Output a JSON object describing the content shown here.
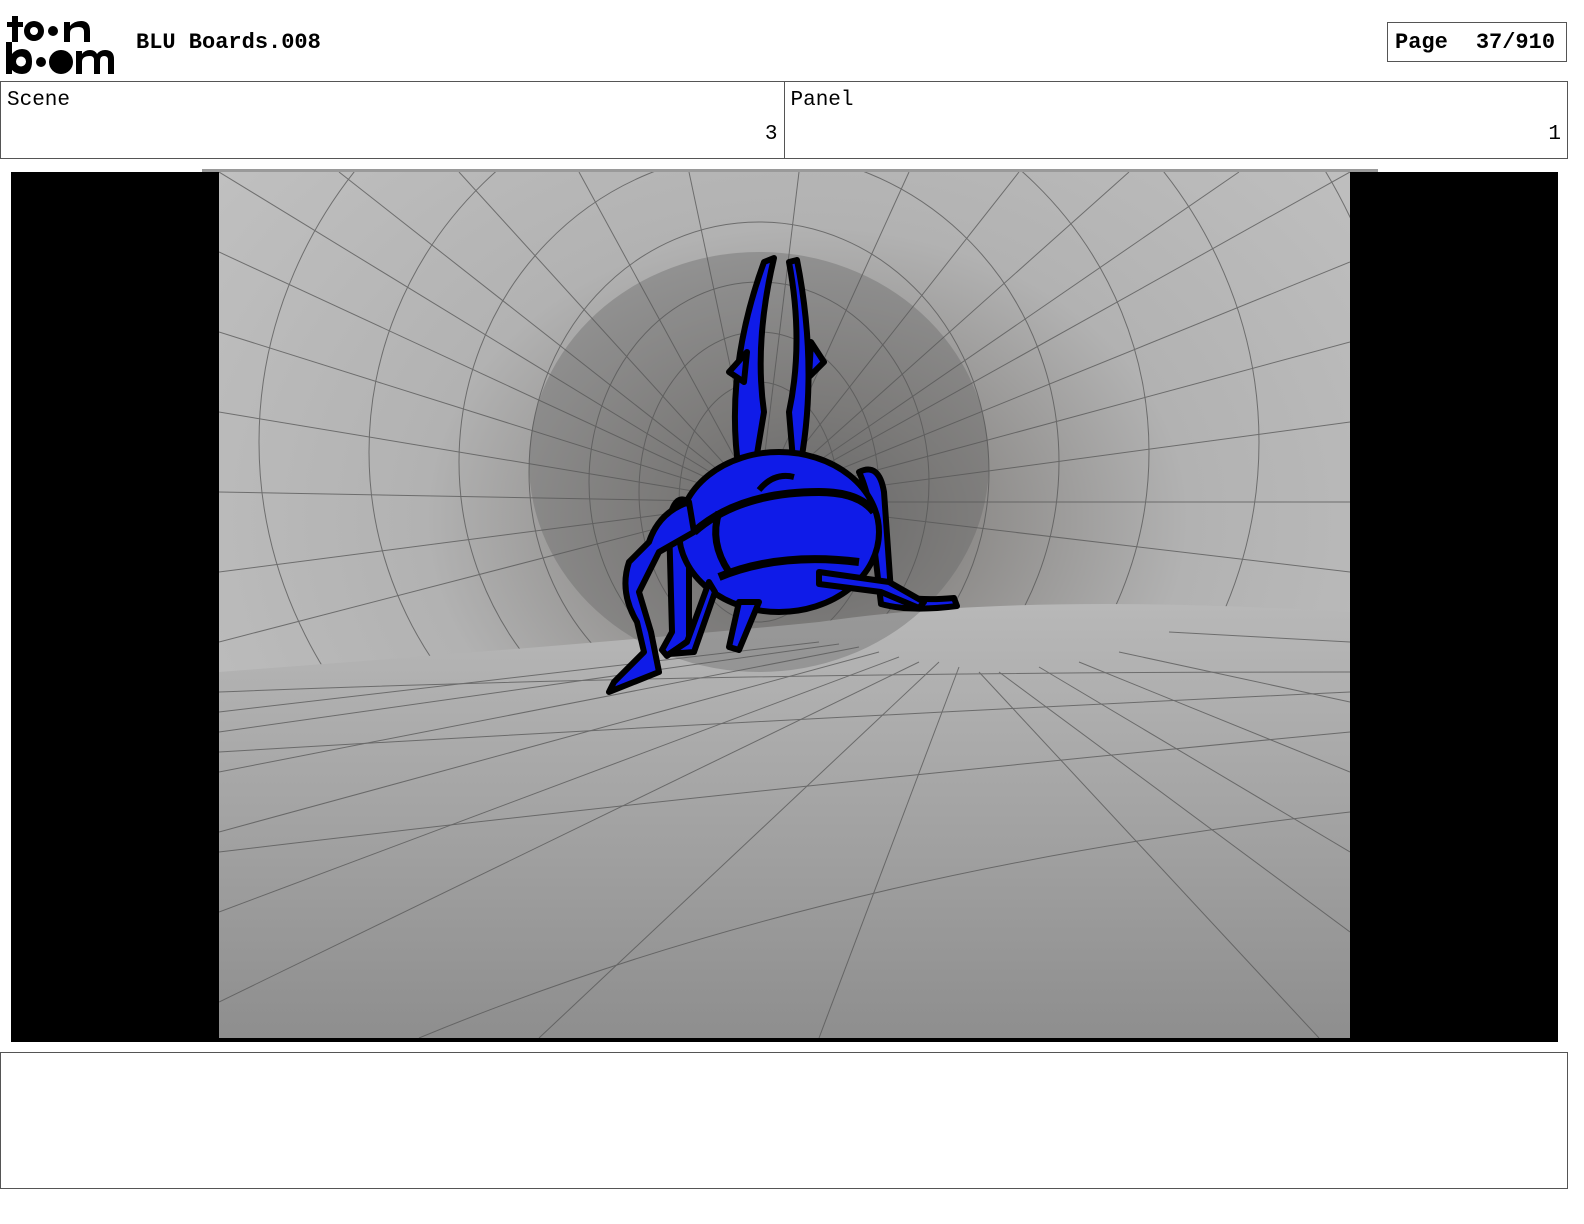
{
  "header": {
    "logo_text": "toonboom",
    "title": "BLU Boards.008",
    "page_label": "Page",
    "page_value": "37/910"
  },
  "info": {
    "scene_label": "Scene",
    "scene_value": "3",
    "panel_label": "Panel",
    "panel_value": "1"
  },
  "colors": {
    "bug_fill": "#0f1be8",
    "outline": "#000000",
    "mesh": "#555555"
  },
  "notes": {
    "text": ""
  }
}
